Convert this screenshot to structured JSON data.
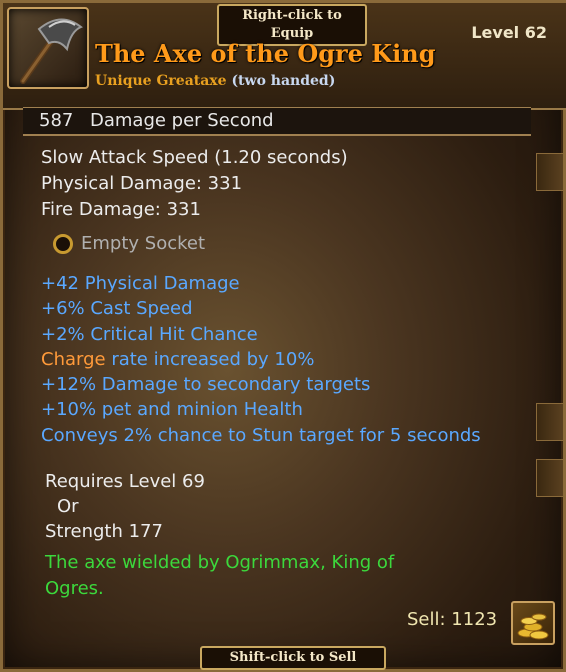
{
  "banners": {
    "equip": "Right-click to Equip",
    "sell": "Shift-click to Sell"
  },
  "item": {
    "level_label": "Level 62",
    "name": "The Axe of the Ogre King",
    "type": "Unique Greataxe",
    "handedness": "(two handed)"
  },
  "dps": {
    "value": "587",
    "label": "Damage per Second"
  },
  "stats": [
    "Slow Attack Speed (1.20 seconds)",
    "Physical Damage: 331",
    "Fire Damage: 331"
  ],
  "socket": "Empty Socket",
  "modifiers": {
    "m1": "+42 Physical Damage",
    "m2": "+6% Cast Speed",
    "m3": "+2% Critical Hit Chance",
    "m4_highlight": "Charge",
    "m4_rest": " rate increased by 10%",
    "m5": "+12% Damage to secondary targets",
    "m6": "+10% pet and minion Health",
    "m7": "Conveys 2% chance to Stun target for 5 seconds"
  },
  "requirements": {
    "level": "Requires Level 69",
    "or": "Or",
    "strength": "Strength 177"
  },
  "flavor": "The axe wielded by Ogrimmax, King of Ogres.",
  "sell": "Sell: 1123",
  "colors": {
    "item_name": "#ff9a1a",
    "modifier": "#5aa8ff",
    "highlight": "#ff9a3a",
    "flavor": "#3cd83c"
  },
  "icons": {
    "item": "greataxe-icon",
    "socket": "socket-ring-icon",
    "gold": "gold-pile-icon"
  }
}
